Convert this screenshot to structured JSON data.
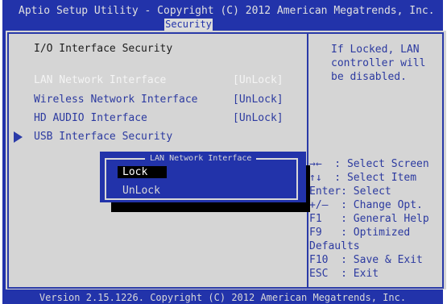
{
  "header": {
    "title": "Aptio Setup Utility - Copyright (C) 2012 American Megatrends, Inc.",
    "active_tab": "Security"
  },
  "main": {
    "section_title": "I/O Interface Security",
    "items": [
      {
        "label": "LAN Network Interface",
        "value": "[UnLock]"
      },
      {
        "label": "Wireless Network Interface",
        "value": "[UnLock]"
      },
      {
        "label": "HD AUDIO Interface",
        "value": "[UnLock]"
      },
      {
        "label": "USB Interface Security",
        "value": ""
      }
    ]
  },
  "help": {
    "text": "If Locked, LAN\ncontroller will\nbe disabled."
  },
  "keys": {
    "lines": "→←  : Select Screen\n↑↓  : Select Item\nEnter: Select\n+/—  : Change Opt.\nF1   : General Help\nF9   : Optimized\nDefaults\nF10  : Save & Exit\nESC  : Exit"
  },
  "popup": {
    "title": "LAN Network Interface",
    "options": [
      "Lock",
      "UnLock"
    ],
    "selected": "Lock"
  },
  "footer": {
    "text": "Version 2.15.1226. Copyright (C) 2012 American Megatrends, Inc."
  }
}
